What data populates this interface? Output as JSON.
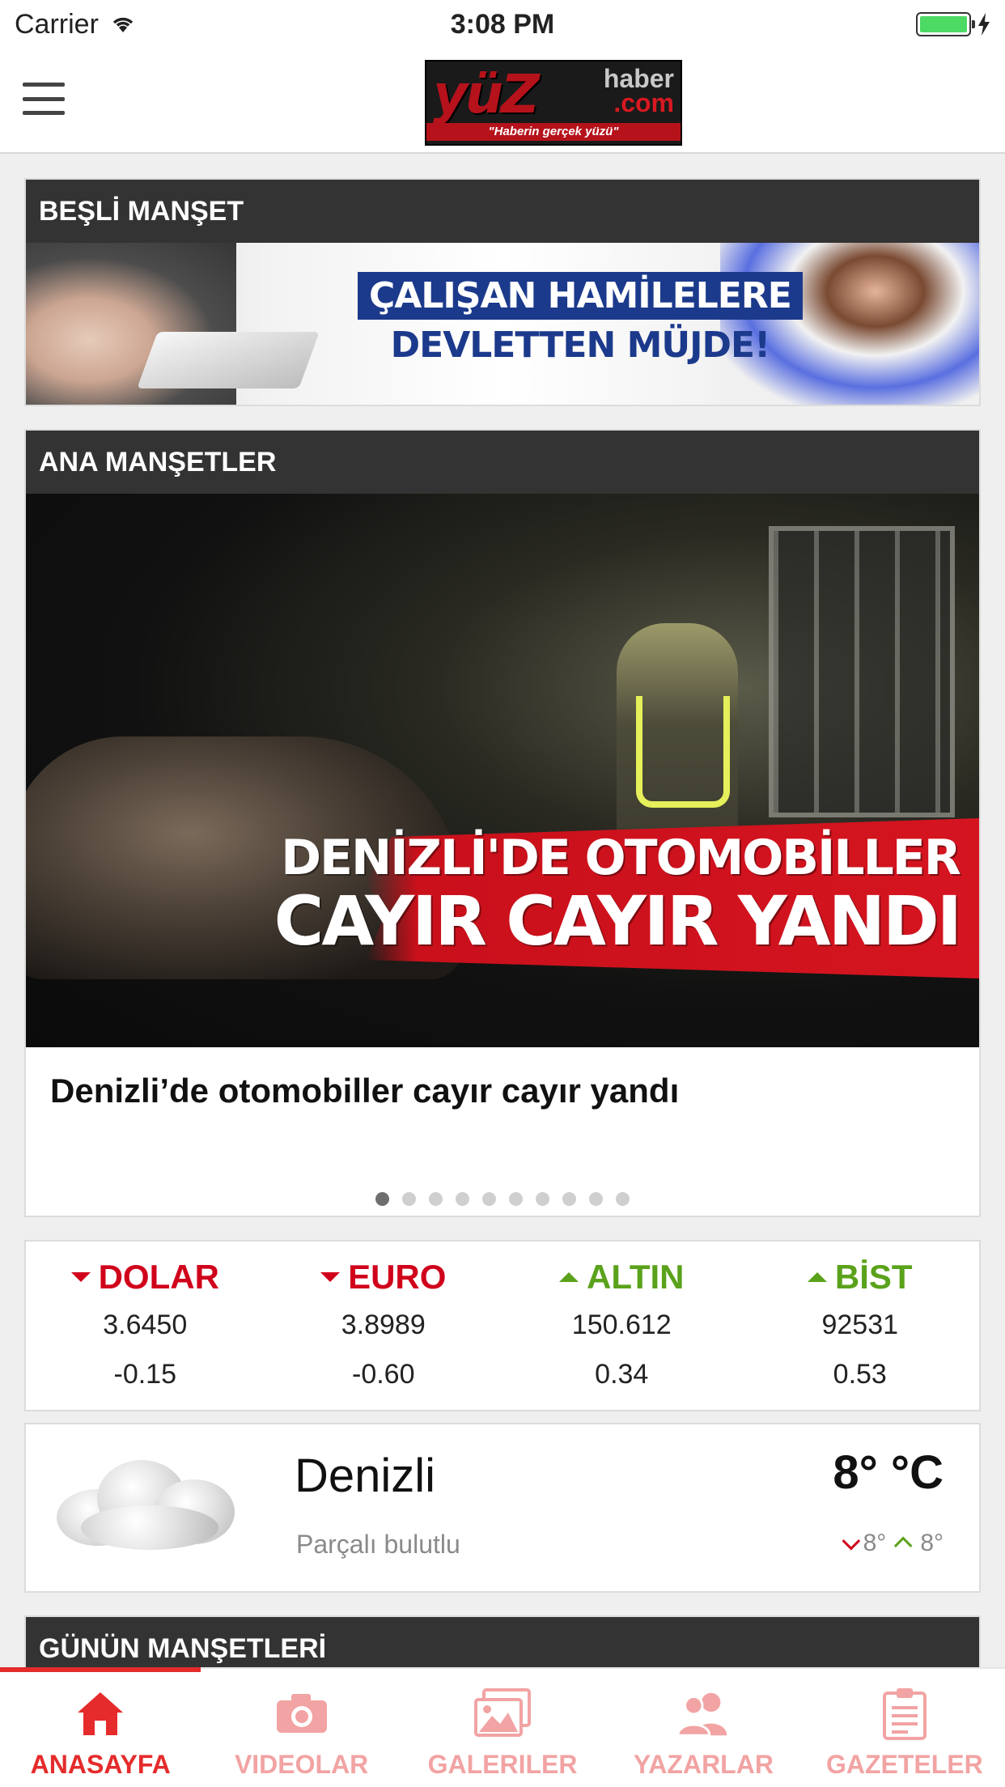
{
  "status_bar": {
    "carrier": "Carrier",
    "time": "3:08 PM",
    "battery_icon": "battery-full-icon",
    "wifi_icon": "wifi-icon",
    "charging_icon": "bolt-icon"
  },
  "header": {
    "menu_icon": "hamburger-icon",
    "logo": {
      "main": "yüZ",
      "side_top": "haber",
      "side_bottom": ".com",
      "tagline": "\"Haberin gerçek yüzü\""
    }
  },
  "besli_manset": {
    "title": "BEŞLİ MANŞET",
    "banner_line1": "ÇALIŞAN HAMİLELERE",
    "banner_line2": "DEVLETTEN MÜJDE!"
  },
  "ana_mansetler": {
    "title": "ANA MANŞETLER",
    "image_caption_line1": "DENİZLİ'DE OTOMOBİLLER",
    "image_caption_line2": "CAYIR CAYIR YANDI",
    "slide_title": "Denizli’de otomobiller cayır cayır yandı",
    "dot_count": 10,
    "active_dot_index": 0
  },
  "currency": [
    {
      "name": "DOLAR",
      "value": "3.6450",
      "change": "-0.15",
      "direction": "down"
    },
    {
      "name": "EURO",
      "value": "3.8989",
      "change": "-0.60",
      "direction": "down"
    },
    {
      "name": "ALTIN",
      "value": "150.612",
      "change": "0.34",
      "direction": "up"
    },
    {
      "name": "BİST",
      "value": "92531",
      "change": "0.53",
      "direction": "up"
    }
  ],
  "weather": {
    "icon": "cloud-icon",
    "city": "Denizli",
    "description": "Parçalı bulutlu",
    "temperature": "8° °C",
    "min": "8°",
    "max": "8°"
  },
  "gunun_mansetleri": {
    "title": "GÜNÜN MANŞETLERİ"
  },
  "tabs": [
    {
      "label": "ANASAYFA",
      "icon": "home-icon",
      "active": true
    },
    {
      "label": "VIDEOLAR",
      "icon": "camera-icon",
      "active": false
    },
    {
      "label": "GALERILER",
      "icon": "gallery-icon",
      "active": false
    },
    {
      "label": "YAZARLAR",
      "icon": "authors-icon",
      "active": false
    },
    {
      "label": "GAZETELER",
      "icon": "newspaper-icon",
      "active": false
    }
  ],
  "colors": {
    "accent": "#e52b2b",
    "down": "#d0021b",
    "up": "#5aa21b",
    "card_header": "#333333"
  }
}
